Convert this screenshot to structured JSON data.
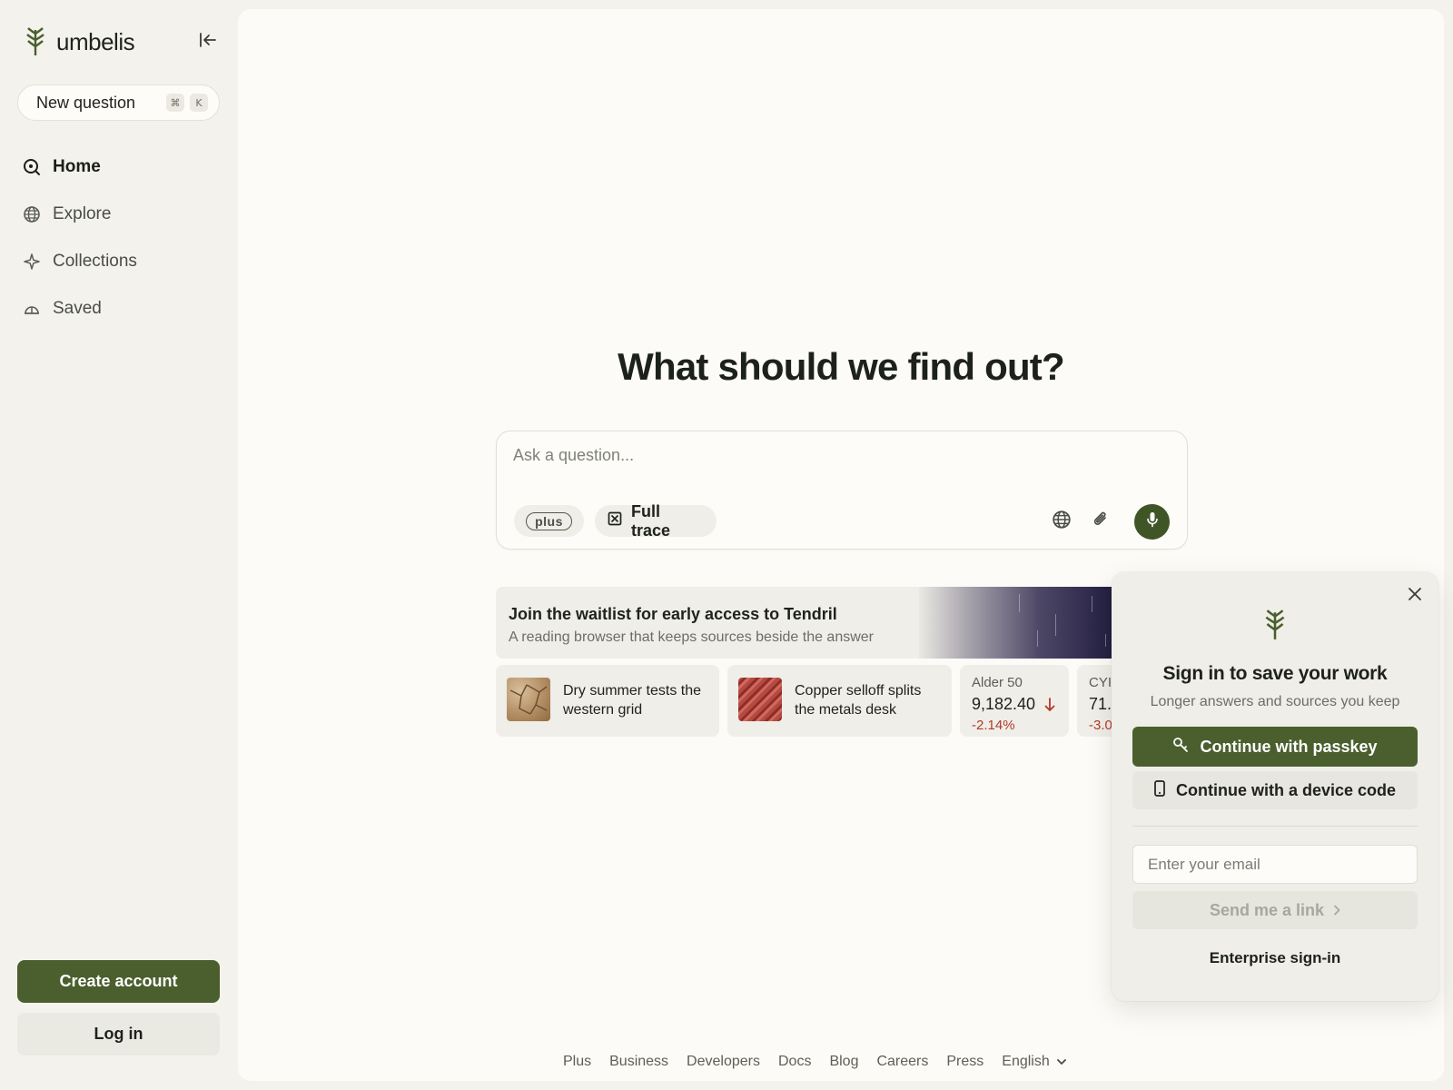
{
  "brand": {
    "name": "umbelis",
    "accent": "#4a5f2d"
  },
  "sidebar": {
    "new_question": {
      "label": "New question",
      "keys": [
        "⌘",
        "K"
      ]
    },
    "items": [
      {
        "label": "Home",
        "icon": "search-icon",
        "active": true
      },
      {
        "label": "Explore",
        "icon": "globe-icon",
        "active": false
      },
      {
        "label": "Collections",
        "icon": "sparkle-icon",
        "active": false
      },
      {
        "label": "Saved",
        "icon": "dome-icon",
        "active": false
      }
    ],
    "create_account": "Create account",
    "log_in": "Log in"
  },
  "main": {
    "title": "What should we find out?",
    "ask": {
      "placeholder": "Ask a question...",
      "plus_chip": "plus",
      "trace_chip": "Full trace"
    },
    "waitlist": {
      "title": "Join the waitlist for early access to Tendril",
      "subtitle": "A reading browser that keeps sources beside the answer"
    },
    "cards": [
      {
        "title": "Dry summer tests the western grid"
      },
      {
        "title": "Copper selloff splits the metals desk"
      }
    ],
    "stocks": [
      {
        "name": "Alder 50",
        "value": "9,182.40",
        "change": "-2.14%"
      },
      {
        "name": "CYI",
        "value": "71.",
        "change": "-3.0"
      }
    ]
  },
  "signin": {
    "title": "Sign in to save your work",
    "subtitle": "Longer answers and sources you keep",
    "passkey": "Continue with passkey",
    "device_code": "Continue with a device code",
    "email_placeholder": "Enter your email",
    "send_link": "Send me a link",
    "enterprise": "Enterprise sign-in"
  },
  "footer": {
    "links": [
      "Plus",
      "Business",
      "Developers",
      "Docs",
      "Blog",
      "Careers",
      "Press"
    ],
    "language": "English"
  }
}
